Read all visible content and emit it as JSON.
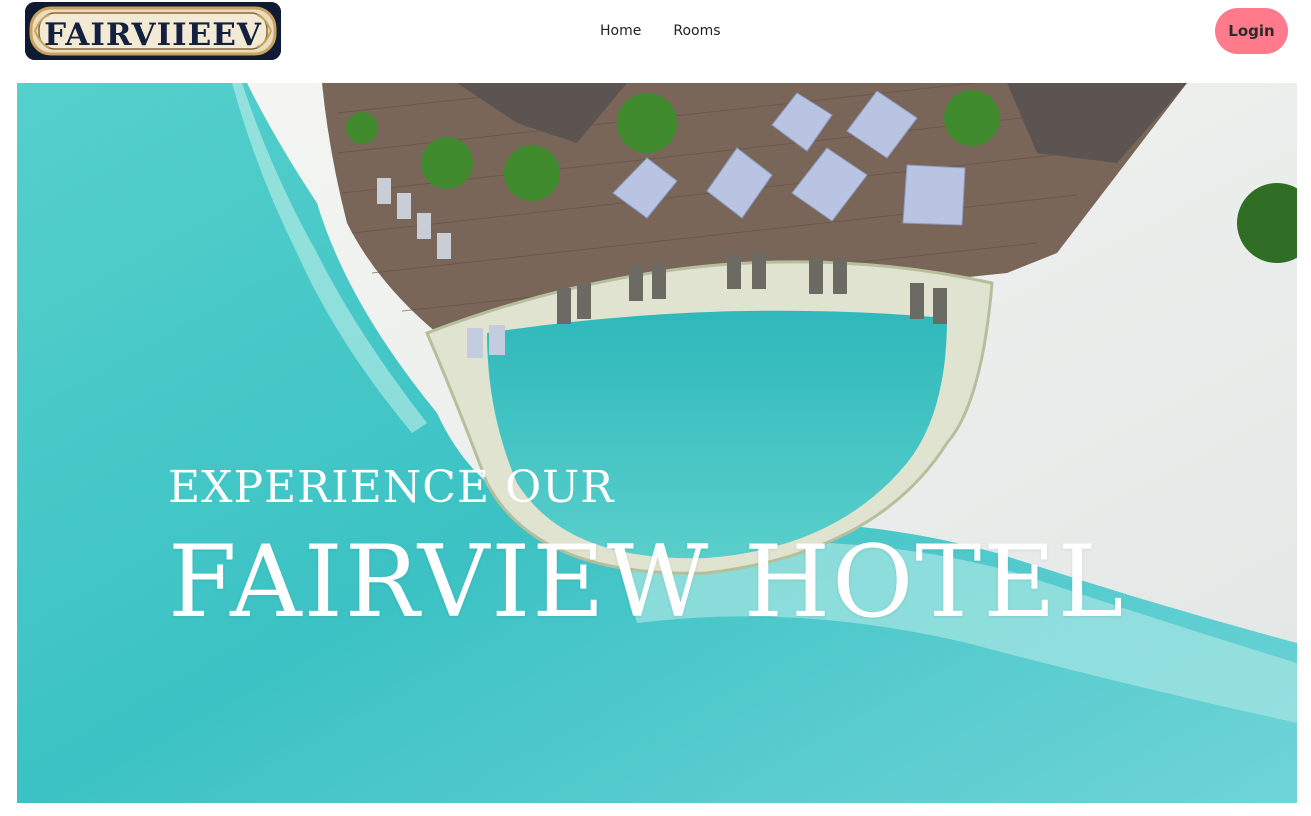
{
  "header": {
    "logo_text": "FAIRVIIEEV",
    "nav": [
      {
        "label": "Home"
      },
      {
        "label": "Rooms"
      }
    ],
    "login_label": "Login"
  },
  "hero": {
    "subtitle": "EXPERIENCE OUR",
    "title": "FAIRVIEW HOTEL",
    "image_description": "aerial-resort-pool-beach"
  },
  "colors": {
    "login_bg": "#ff7a8a",
    "logo_bg": "#0f1a33",
    "logo_gold": "#c9a35a",
    "sea": "#3ec4c4",
    "sand": "#eef0ee"
  }
}
